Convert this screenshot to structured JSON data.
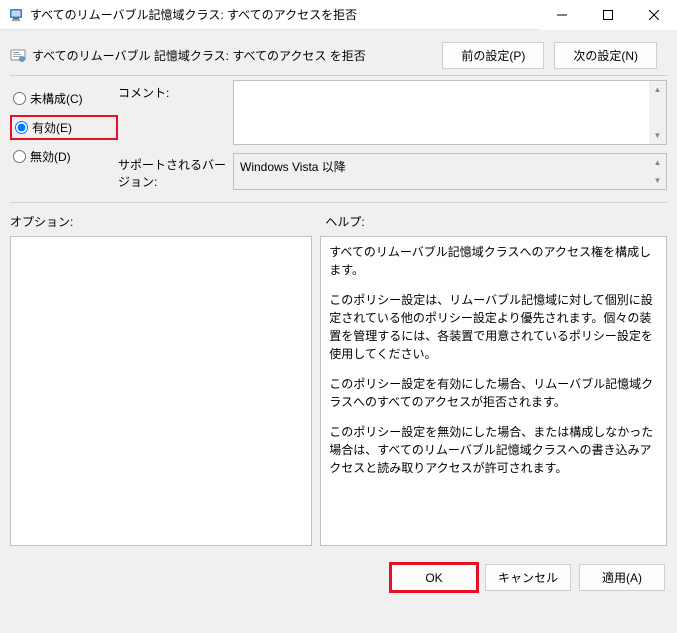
{
  "window": {
    "title": "すべてのリムーバブル記憶域クラス: すべてのアクセスを拒否"
  },
  "header": {
    "subtitle": "すべてのリムーバブル 記憶域クラス: すべてのアクセス を拒否",
    "prev_button": "前の設定(P)",
    "next_button": "次の設定(N)"
  },
  "radios": {
    "not_configured": "未構成(C)",
    "enabled": "有効(E)",
    "disabled": "無効(D)",
    "selected": "enabled"
  },
  "labels": {
    "comment": "コメント:",
    "supported": "サポートされるバージョン:",
    "options": "オプション:",
    "help": "ヘルプ:"
  },
  "fields": {
    "comment": "",
    "supported": "Windows Vista 以降"
  },
  "help": {
    "p1": "すべてのリムーバブル記憶域クラスへのアクセス権を構成します。",
    "p2": "このポリシー設定は、リムーバブル記憶域に対して個別に設定されている他のポリシー設定より優先されます。個々の装置を管理するには、各装置で用意されているポリシー設定を使用してください。",
    "p3": "このポリシー設定を有効にした場合、リムーバブル記憶域クラスへのすべてのアクセスが拒否されます。",
    "p4": "このポリシー設定を無効にした場合、または構成しなかった場合は、すべてのリムーバブル記憶域クラスへの書き込みアクセスと読み取りアクセスが許可されます。"
  },
  "footer": {
    "ok": "OK",
    "cancel": "キャンセル",
    "apply": "適用(A)"
  }
}
